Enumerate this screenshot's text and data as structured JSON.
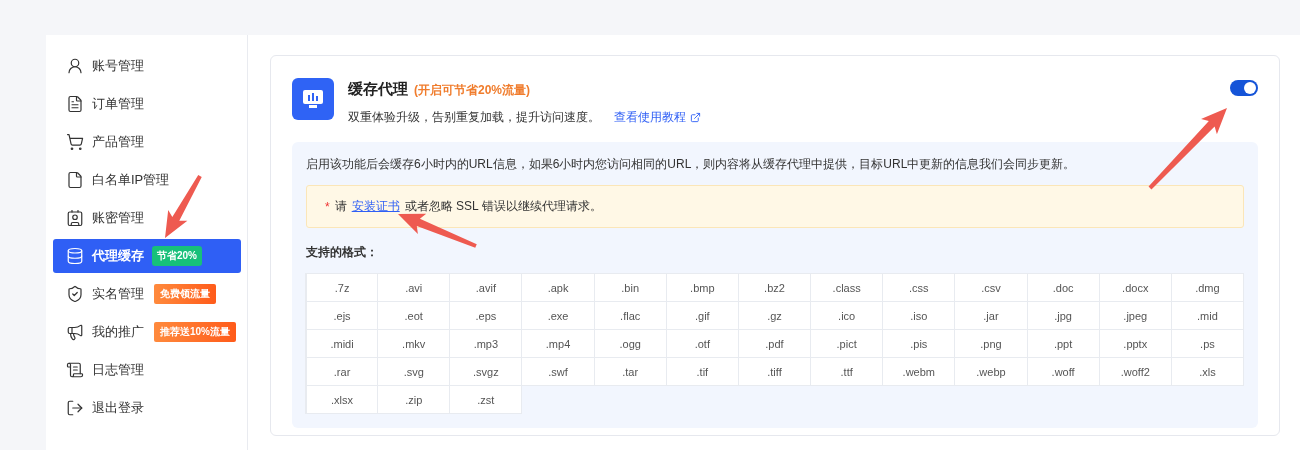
{
  "sidebar": {
    "items": [
      {
        "label": "账号管理",
        "selected": false
      },
      {
        "label": "订单管理",
        "selected": false
      },
      {
        "label": "产品管理",
        "selected": false
      },
      {
        "label": "白名单IP管理",
        "selected": false
      },
      {
        "label": "账密管理",
        "selected": false
      },
      {
        "label": "代理缓存",
        "selected": true,
        "badge": {
          "text": "节省20%",
          "kind": "plain"
        }
      },
      {
        "label": "实名管理",
        "selected": false,
        "badge": {
          "text": "免费领流量",
          "kind": "tag"
        }
      },
      {
        "label": "我的推广",
        "selected": false,
        "badge": {
          "text": "推荐送10%流量",
          "kind": "tag"
        }
      },
      {
        "label": "日志管理",
        "selected": false
      },
      {
        "label": "退出登录",
        "selected": false
      }
    ]
  },
  "card": {
    "title": "缓存代理",
    "title_note": "(开启可节省20%流量)",
    "subtitle": "双重体验升级，告别重复加载，提升访问速度。",
    "tutorial_link": "查看使用教程",
    "toggle": {
      "on": true
    },
    "description": "启用该功能后会缓存6小时内的URL信息，如果6小时内您访问相同的URL，则内容将从缓存代理中提供，目标URL中更新的信息我们会同步更新。",
    "notice": {
      "mark": "*",
      "before": "请",
      "link": "安装证书",
      "after": "或者忽略 SSL 错误以继续代理请求。"
    },
    "formats_label": "支持的格式：",
    "formats": [
      ".7z",
      ".avi",
      ".avif",
      ".apk",
      ".bin",
      ".bmp",
      ".bz2",
      ".class",
      ".css",
      ".csv",
      ".doc",
      ".docx",
      ".dmg",
      ".ejs",
      ".eot",
      ".eps",
      ".exe",
      ".flac",
      ".gif",
      ".gz",
      ".ico",
      ".iso",
      ".jar",
      ".jpg",
      ".jpeg",
      ".mid",
      ".midi",
      ".mkv",
      ".mp3",
      ".mp4",
      ".ogg",
      ".otf",
      ".pdf",
      ".pict",
      ".pis",
      ".png",
      ".ppt",
      ".pptx",
      ".ps",
      ".rar",
      ".svg",
      ".svgz",
      ".swf",
      ".tar",
      ".tif",
      ".tiff",
      ".ttf",
      ".webm",
      ".webp",
      ".woff",
      ".woff2",
      ".xls",
      ".xlsx",
      ".zip",
      ".zst"
    ]
  }
}
